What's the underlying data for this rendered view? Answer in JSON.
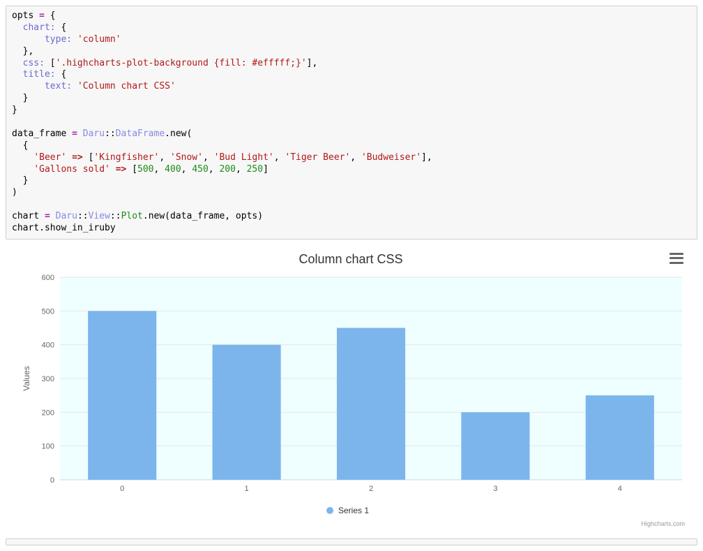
{
  "code": {
    "line1a": "opts ",
    "line1b": " {",
    "line2a": "  ",
    "line2b": " {",
    "chart_key": "chart:",
    "line3a": "      ",
    "type_key": "type:",
    "type_val": "'column'",
    "line4": "  },",
    "line5a": "  ",
    "css_key": "css:",
    "css_val": "'.highcharts-plot-background {fill: #efffff;}'",
    "line5b": " [",
    "line5c": "],",
    "line6a": "  ",
    "title_key": "title:",
    "line6b": " {",
    "line7a": "      ",
    "text_key": "text:",
    "text_val": "'Column chart CSS'",
    "line8": "  }",
    "line9": "}",
    "line11a": "data_frame ",
    "daru": "Daru",
    "sep": "::",
    "dataframe": "DataFrame",
    "dotnew": ".new(",
    "line12": "  {",
    "line13a": "    ",
    "beer_key": "'Beer'",
    "arrow": " => ",
    "b1": "'Kingfisher'",
    "b2": "'Snow'",
    "b3": "'Bud Light'",
    "b4": "'Tiger Beer'",
    "b5": "'Budweiser'",
    "line14a": "    ",
    "gallons_key": "'Gallons sold'",
    "v1": "500",
    "v2": "400",
    "v3": "450",
    "v4": "200",
    "v5": "250",
    "line15": "  }",
    "line16": ")",
    "line18a": "chart ",
    "view": "View",
    "plot": "Plot",
    "newargs": ".new(data_frame, opts)",
    "line19": "chart.show_in_iruby",
    "eq": "="
  },
  "chart_data": {
    "type": "bar",
    "title": "Column chart CSS",
    "categories": [
      "0",
      "1",
      "2",
      "3",
      "4"
    ],
    "values": [
      500,
      400,
      450,
      200,
      250
    ],
    "series_name": "Series 1",
    "ylabel": "Values",
    "xlabel": "",
    "ylim": [
      0,
      600
    ],
    "yticks": [
      0,
      100,
      200,
      300,
      400,
      500,
      600
    ],
    "plot_bg": "#efffff",
    "bar_color": "#7cb5ec",
    "credits": "Highcharts.com"
  }
}
